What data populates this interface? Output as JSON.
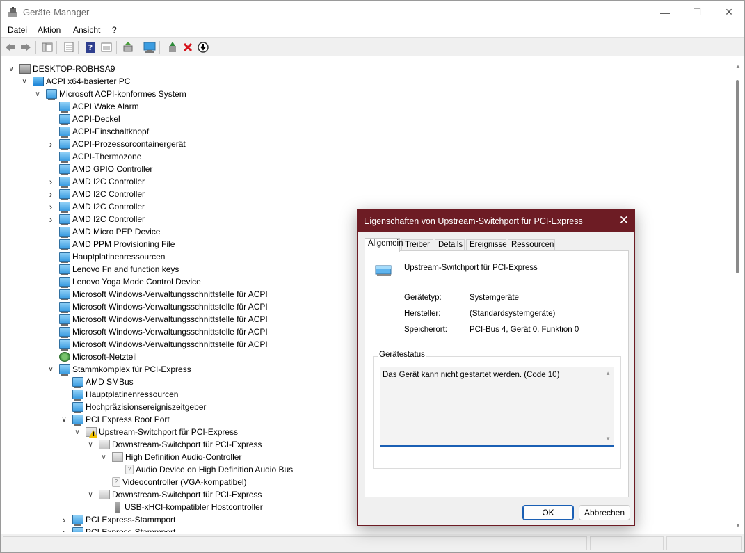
{
  "window": {
    "title": "Geräte-Manager"
  },
  "menu": [
    "Datei",
    "Aktion",
    "Ansicht",
    "?"
  ],
  "toolbar": [
    "back-arrow-icon",
    "forward-arrow-icon",
    "show-hide-tree-icon",
    "properties-icon",
    "help-icon",
    "view-icon",
    "update-driver-icon",
    "scan-hardware-icon",
    "enable-device-icon",
    "uninstall-icon",
    "disable-icon"
  ],
  "tree": [
    {
      "label": "DESKTOP-ROBHSA9",
      "level": 0,
      "exp": "open",
      "icon": "pc"
    },
    {
      "label": "ACPI x64-basierter PC",
      "level": 1,
      "exp": "open",
      "icon": "pc"
    },
    {
      "label": "Microsoft ACPI-konformes System",
      "level": 2,
      "exp": "open",
      "icon": "dev"
    },
    {
      "label": "ACPI Wake Alarm",
      "level": 3,
      "exp": "",
      "icon": "dev"
    },
    {
      "label": "ACPI-Deckel",
      "level": 3,
      "exp": "",
      "icon": "dev"
    },
    {
      "label": "ACPI-Einschaltknopf",
      "level": 3,
      "exp": "",
      "icon": "dev"
    },
    {
      "label": "ACPI-Prozessorcontainergerät",
      "level": 3,
      "exp": "closed",
      "icon": "dev"
    },
    {
      "label": "ACPI-Thermozone",
      "level": 3,
      "exp": "",
      "icon": "dev"
    },
    {
      "label": "AMD GPIO Controller",
      "level": 3,
      "exp": "",
      "icon": "dev"
    },
    {
      "label": "AMD I2C Controller",
      "level": 3,
      "exp": "closed",
      "icon": "dev"
    },
    {
      "label": "AMD I2C Controller",
      "level": 3,
      "exp": "closed",
      "icon": "dev"
    },
    {
      "label": "AMD I2C Controller",
      "level": 3,
      "exp": "closed",
      "icon": "dev"
    },
    {
      "label": "AMD I2C Controller",
      "level": 3,
      "exp": "closed",
      "icon": "dev"
    },
    {
      "label": "AMD Micro PEP Device",
      "level": 3,
      "exp": "",
      "icon": "dev"
    },
    {
      "label": "AMD PPM Provisioning File",
      "level": 3,
      "exp": "",
      "icon": "dev"
    },
    {
      "label": "Hauptplatinenressourcen",
      "level": 3,
      "exp": "",
      "icon": "dev"
    },
    {
      "label": "Lenovo Fn and function keys",
      "level": 3,
      "exp": "",
      "icon": "dev"
    },
    {
      "label": "Lenovo Yoga Mode Control Device",
      "level": 3,
      "exp": "",
      "icon": "dev"
    },
    {
      "label": "Microsoft Windows-Verwaltungsschnittstelle für ACPI",
      "level": 3,
      "exp": "",
      "icon": "dev"
    },
    {
      "label": "Microsoft Windows-Verwaltungsschnittstelle für ACPI",
      "level": 3,
      "exp": "",
      "icon": "dev"
    },
    {
      "label": "Microsoft Windows-Verwaltungsschnittstelle für ACPI",
      "level": 3,
      "exp": "",
      "icon": "dev"
    },
    {
      "label": "Microsoft Windows-Verwaltungsschnittstelle für ACPI",
      "level": 3,
      "exp": "",
      "icon": "dev"
    },
    {
      "label": "Microsoft Windows-Verwaltungsschnittstelle für ACPI",
      "level": 3,
      "exp": "",
      "icon": "dev"
    },
    {
      "label": "Microsoft-Netzteil",
      "level": 3,
      "exp": "",
      "icon": "power"
    },
    {
      "label": "Stammkomplex für PCI-Express",
      "level": 3,
      "exp": "open",
      "icon": "dev"
    },
    {
      "label": "AMD SMBus",
      "level": 4,
      "exp": "",
      "icon": "dev"
    },
    {
      "label": "Hauptplatinenressourcen",
      "level": 4,
      "exp": "",
      "icon": "dev"
    },
    {
      "label": "Hochpräzisionsereigniszeitgeber",
      "level": 4,
      "exp": "",
      "icon": "dev"
    },
    {
      "label": "PCI Express Root Port",
      "level": 4,
      "exp": "open",
      "icon": "dev"
    },
    {
      "label": "Upstream-Switchport für PCI-Express",
      "level": 5,
      "exp": "open",
      "icon": "warn"
    },
    {
      "label": "Downstream-Switchport für PCI-Express",
      "level": 6,
      "exp": "open",
      "icon": "gray"
    },
    {
      "label": "High Definition Audio-Controller",
      "level": 7,
      "exp": "open",
      "icon": "gray"
    },
    {
      "label": "Audio Device on High Definition Audio Bus",
      "level": 8,
      "exp": "",
      "icon": "unk"
    },
    {
      "label": "Videocontroller (VGA-kompatibel)",
      "level": 7,
      "exp": "",
      "icon": "unk"
    },
    {
      "label": "Downstream-Switchport für PCI-Express",
      "level": 6,
      "exp": "open",
      "icon": "gray"
    },
    {
      "label": "USB-xHCI-kompatibler Hostcontroller",
      "level": 7,
      "exp": "",
      "icon": "usb"
    },
    {
      "label": "PCI Express-Stammport",
      "level": 4,
      "exp": "closed",
      "icon": "dev"
    },
    {
      "label": "PCI Express-Stammport",
      "level": 4,
      "exp": "closed",
      "icon": "dev"
    }
  ],
  "dialog": {
    "title": "Eigenschaften von Upstream-Switchport für PCI-Express",
    "close": "✕",
    "tabs": [
      "Allgemein",
      "Treiber",
      "Details",
      "Ereignisse",
      "Ressourcen"
    ],
    "active_tab": "Allgemein",
    "device_name": "Upstream-Switchport für PCI-Express",
    "props": [
      {
        "label": "Gerätetyp:",
        "value": "Systemgeräte"
      },
      {
        "label": "Hersteller:",
        "value": "(Standardsystemgeräte)"
      },
      {
        "label": "Speicherort:",
        "value": "PCI-Bus 4, Gerät 0, Funktion 0"
      }
    ],
    "status_caption": "Gerätestatus",
    "status_text": "Das Gerät kann nicht gestartet werden. (Code 10)",
    "ok": "OK",
    "cancel": "Abbrechen"
  }
}
